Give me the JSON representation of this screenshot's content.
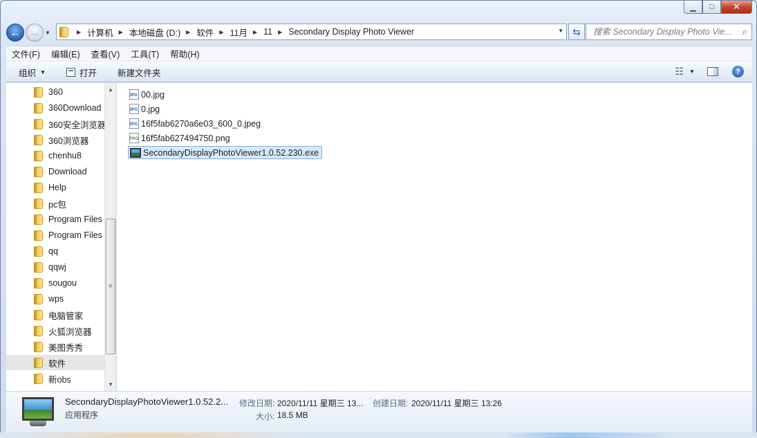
{
  "window": {
    "caption_buttons": [
      "minimize",
      "maximize",
      "close"
    ]
  },
  "address_bar": {
    "breadcrumbs": [
      "计算机",
      "本地磁盘 (D:)",
      "软件",
      "11月",
      "11",
      "Secondary Display Photo Viewer"
    ]
  },
  "search": {
    "placeholder": "搜索 Secondary Display Photo Vie..."
  },
  "menu": {
    "items": [
      "文件(F)",
      "编辑(E)",
      "查看(V)",
      "工具(T)",
      "帮助(H)"
    ]
  },
  "toolbar": {
    "organize_label": "组织",
    "open_label": "打开",
    "new_folder_label": "新建文件夹"
  },
  "nav_tree": {
    "items": [
      "360",
      "360Download",
      "360安全浏览器",
      "360浏览器",
      "chenhu8",
      "Download",
      "Help",
      "pc包",
      "Program Files",
      "Program Files",
      "qq",
      "qqwj",
      "sougou",
      "wps",
      "电脑管家",
      "火狐浏览器",
      "美图秀秀",
      "软件",
      "新obs"
    ],
    "selected": "软件"
  },
  "files": [
    {
      "name": "00.jpg",
      "icon": "jpg-file-icon"
    },
    {
      "name": "0.jpg",
      "icon": "jpg-file-icon"
    },
    {
      "name": "16f5fab6270a6e03_600_0.jpeg",
      "icon": "jpg-file-icon"
    },
    {
      "name": "16f5fab627494750.png",
      "icon": "png-file-icon"
    },
    {
      "name": "SecondaryDisplayPhotoViewer1.0.52.230.exe",
      "icon": "exe-file-icon",
      "selected": true
    }
  ],
  "details": {
    "name": "SecondaryDisplayPhotoViewer1.0.52.2...",
    "type": "应用程序",
    "modified_label": "修改日期:",
    "modified_value": "2020/11/11 星期三 13...",
    "created_label": "创建日期:",
    "created_value": "2020/11/11 星期三 13:26",
    "size_label": "大小:",
    "size_value": "18.5 MB"
  }
}
